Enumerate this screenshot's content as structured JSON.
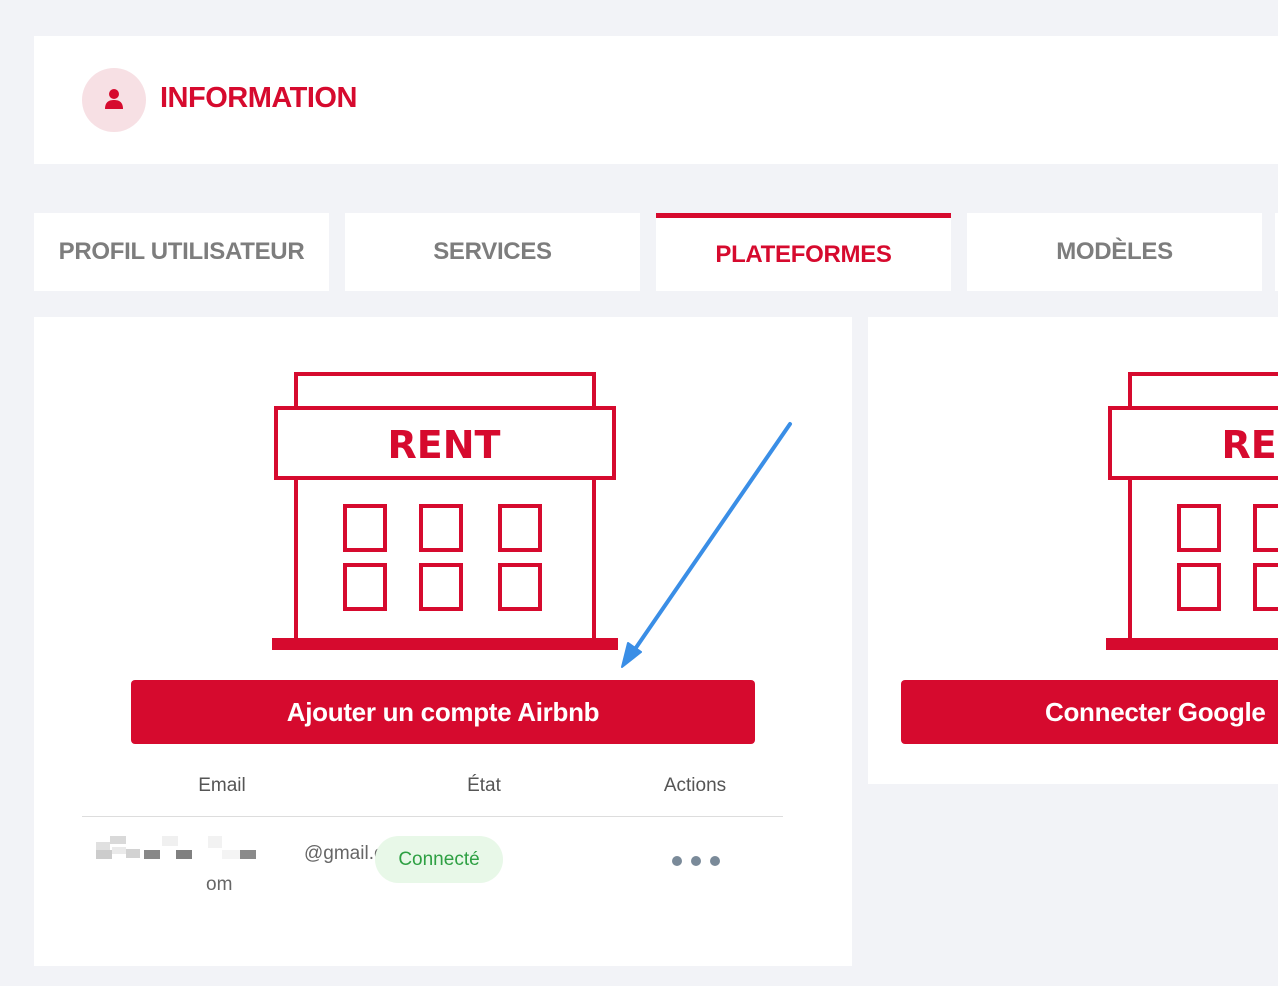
{
  "header": {
    "title": "INFORMATION",
    "icon": "user-icon"
  },
  "tabs": [
    {
      "label": "PROFIL UTILISATEUR",
      "active": false
    },
    {
      "label": "SERVICES",
      "active": false
    },
    {
      "label": "PLATEFORMES",
      "active": true
    },
    {
      "label": "MODÈLES",
      "active": false
    }
  ],
  "cards": {
    "airbnb": {
      "illustration_text": "RENT",
      "button_label": "Ajouter un compte Airbnb",
      "table": {
        "headers": [
          "Email",
          "État",
          "Actions"
        ],
        "rows": [
          {
            "email_visible": "@gmail.c",
            "email_wrap": "om",
            "status": "Connecté",
            "actions_icon": "more-horizontal-icon"
          }
        ]
      }
    },
    "google": {
      "illustration_text": "RENT",
      "button_label": "Connecter Google"
    }
  },
  "colors": {
    "accent": "#d60a2e",
    "avatar_bg": "#f7e0e4",
    "badge_bg": "#e8f8e8",
    "badge_text": "#2ea043",
    "page_bg": "#f2f3f7",
    "annotation_arrow": "#3a8ee6"
  }
}
